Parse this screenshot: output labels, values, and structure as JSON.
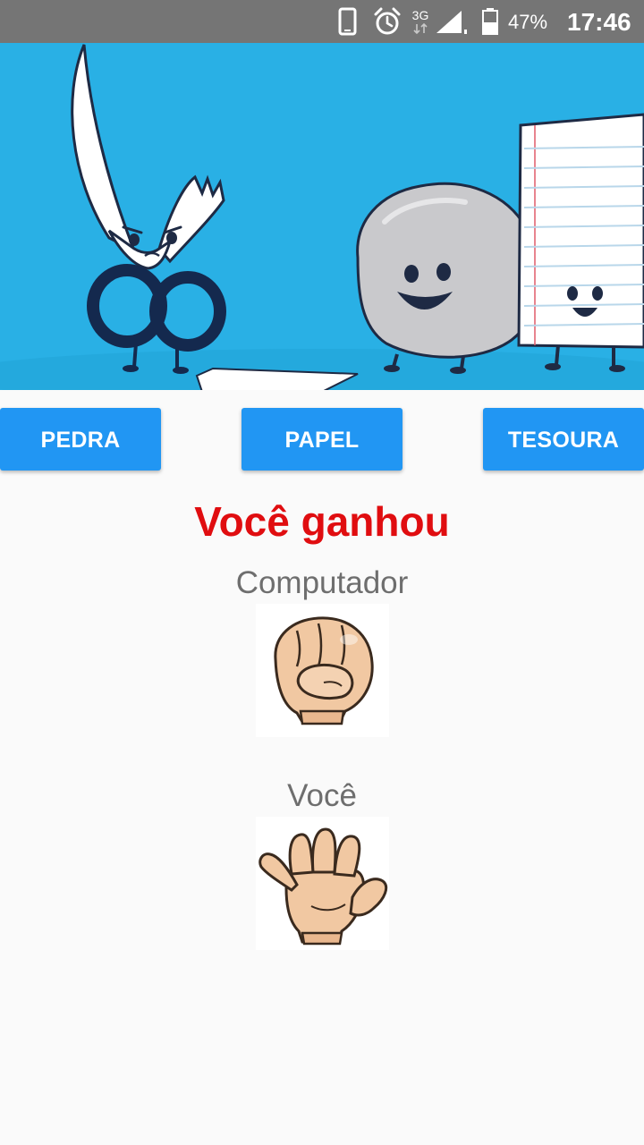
{
  "status_bar": {
    "icons": [
      "phone-icon",
      "alarm-icon",
      "network-3g-icon",
      "signal-icon",
      "battery-icon"
    ],
    "network_label": "3G",
    "battery_percent": "47%",
    "time": "17:46",
    "background": "#757575"
  },
  "hero": {
    "image": "rock-paper-scissors-characters-banner",
    "background": "#29b0e5"
  },
  "buttons": {
    "rock": "PEDRA",
    "paper": "PAPEL",
    "scissors": "TESOURA",
    "color": "#2196f3"
  },
  "result": {
    "text": "Você ganhou",
    "color": "#e00d10"
  },
  "computer": {
    "label": "Computador",
    "choice_icon": "fist-rock-icon"
  },
  "player": {
    "label": "Você",
    "choice_icon": "open-hand-paper-icon"
  }
}
